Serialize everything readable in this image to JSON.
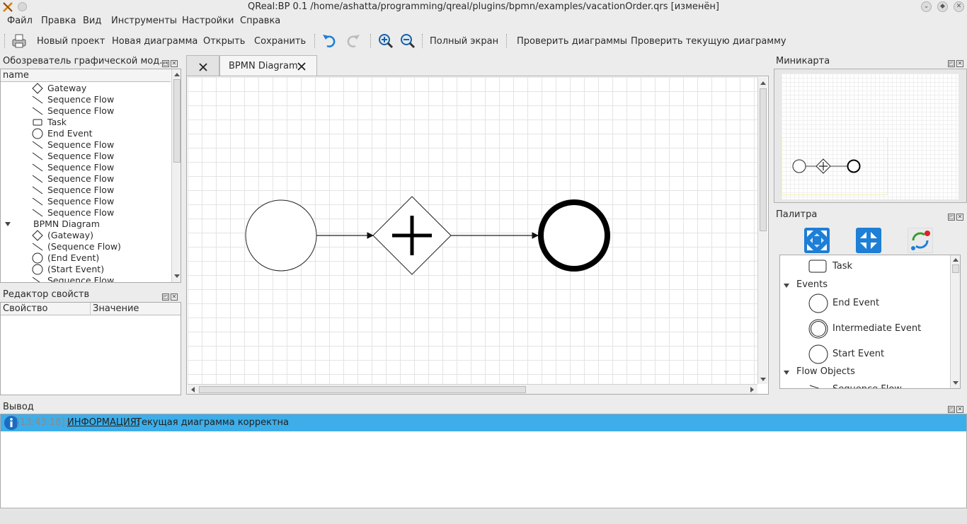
{
  "window": {
    "title": "QReal:BP 0.1 /home/ashatta/programming/qreal/plugins/bpmn/examples/vacationOrder.qrs [изменён]"
  },
  "menu": [
    "Файл",
    "Правка",
    "Вид",
    "Инструменты",
    "Настройки",
    "Справка"
  ],
  "toolbar": {
    "new_project": "Новый проект",
    "new_diagram": "Новая диаграмма",
    "open": "Открыть",
    "save": "Сохранить",
    "fullscreen": "Полный экран",
    "check_diagrams": "Проверить диаграммы",
    "check_current": "Проверить текущую диаграмму"
  },
  "explorer": {
    "title": "Обозреватель графической мод...",
    "column": "name",
    "items": [
      {
        "label": "Gateway",
        "icon": "gateway-icon"
      },
      {
        "label": "Sequence Flow",
        "icon": "sequence-flow-icon"
      },
      {
        "label": "Sequence Flow",
        "icon": "sequence-flow-icon"
      },
      {
        "label": "Task",
        "icon": "task-icon"
      },
      {
        "label": "End Event",
        "icon": "event-icon"
      },
      {
        "label": "Sequence Flow",
        "icon": "sequence-flow-icon"
      },
      {
        "label": "Sequence Flow",
        "icon": "sequence-flow-icon"
      },
      {
        "label": "Sequence Flow",
        "icon": "sequence-flow-icon"
      },
      {
        "label": "Sequence Flow",
        "icon": "sequence-flow-icon"
      },
      {
        "label": "Sequence Flow",
        "icon": "sequence-flow-icon"
      },
      {
        "label": "Sequence Flow",
        "icon": "sequence-flow-icon"
      },
      {
        "label": "Sequence Flow",
        "icon": "sequence-flow-icon"
      }
    ],
    "group": "BPMN Diagram",
    "group_items": [
      {
        "label": "(Gateway)",
        "icon": "gateway-icon"
      },
      {
        "label": "(Sequence Flow)",
        "icon": "sequence-flow-icon"
      },
      {
        "label": "(End Event)",
        "icon": "event-icon"
      },
      {
        "label": "(Start Event)",
        "icon": "event-icon"
      },
      {
        "label": "Sequence Flow",
        "icon": "sequence-flow-icon"
      }
    ]
  },
  "properties": {
    "title": "Редактор свойств",
    "col_property": "Свойство",
    "col_value": "Значение"
  },
  "tabs": {
    "diagram_tab": "BPMN Diagram"
  },
  "minimap": {
    "title": "Миникарта"
  },
  "palette": {
    "title": "Палитра",
    "items": {
      "task": "Task",
      "events_group": "Events",
      "end_event": "End Event",
      "intermediate_event": "Intermediate Event",
      "start_event": "Start Event",
      "flow_objects_group": "Flow Objects",
      "sequence_flow": "Sequence Flow"
    }
  },
  "output": {
    "title": "Вывод",
    "time": "[13:43:18]:",
    "level": "ИНФОРМАЦИЯ:",
    "text": "Текущая диаграмма корректна"
  },
  "colors": {
    "selection": "#3daee9",
    "icon_blue": "#1d7fd6",
    "canvas_grid": "#e4e4e4"
  }
}
